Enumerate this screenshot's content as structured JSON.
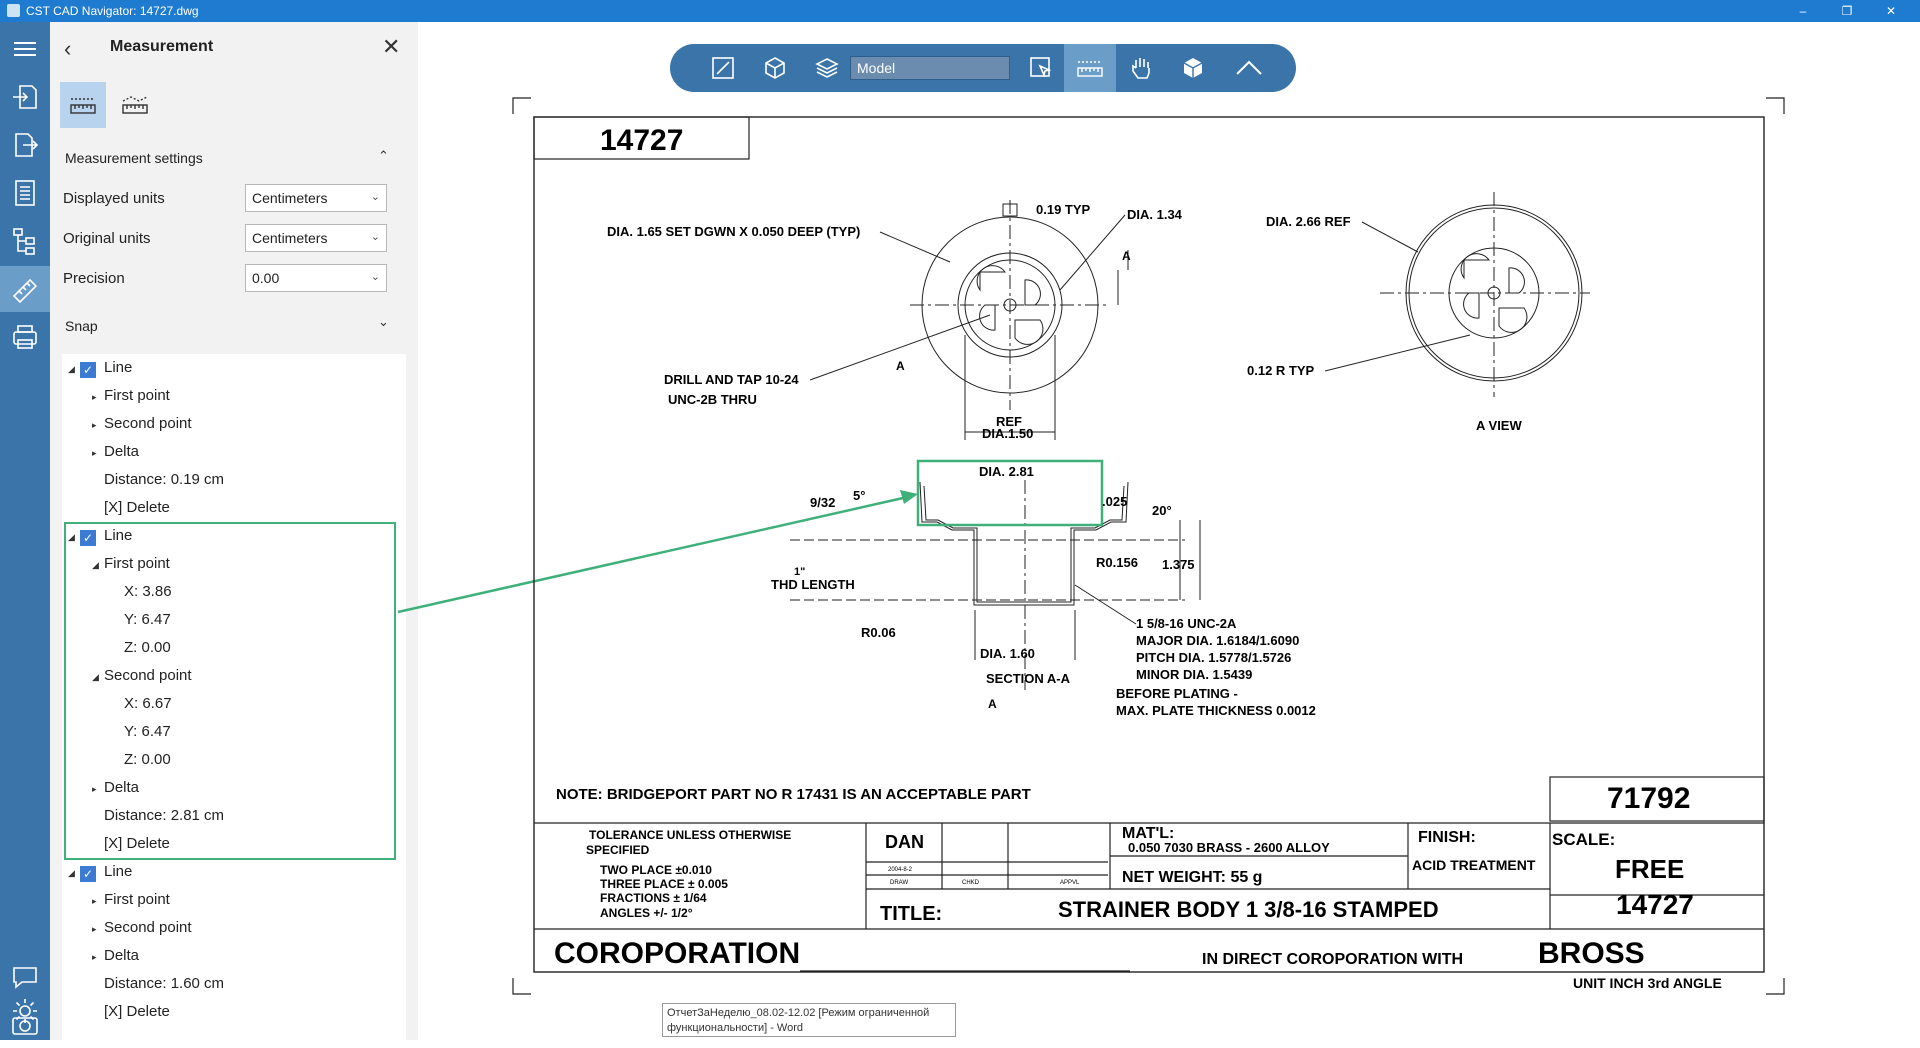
{
  "window": {
    "title": "CST CAD Navigator: 14727.dwg"
  },
  "panel": {
    "title": "Measurement",
    "settings_header": "Measurement settings",
    "displayed_units_label": "Displayed units",
    "displayed_units_value": "Centimeters",
    "original_units_label": "Original units",
    "original_units_value": "Centimeters",
    "precision_label": "Precision",
    "precision_value": "0.00",
    "snap_label": "Snap"
  },
  "tree": {
    "line1": {
      "label": "Line",
      "first": "First point",
      "second": "Second point",
      "delta": "Delta",
      "distance": "Distance: 0.19 cm",
      "delete": "[X] Delete"
    },
    "line2": {
      "label": "Line",
      "first": "First point",
      "fx": "X: 3.86",
      "fy": "Y: 6.47",
      "fz": "Z: 0.00",
      "second": "Second point",
      "sx": "X: 6.67",
      "sy": "Y: 6.47",
      "sz": "Z: 0.00",
      "delta": "Delta",
      "distance": "Distance: 2.81 cm",
      "delete": "[X] Delete"
    },
    "line3": {
      "label": "Line",
      "first": "First point",
      "second": "Second point",
      "delta": "Delta",
      "distance": "Distance: 1.60 cm",
      "delete": "[X] Delete"
    }
  },
  "toolbar": {
    "model_value": "Model"
  },
  "drawing": {
    "dwg_no_top": "14727",
    "labels": {
      "dia165": "DIA. 1.65 SET DGWN X 0.050 DEEP (TYP)",
      "typ019": "0.19 TYP",
      "dia134": "DIA. 1.34",
      "a_top": "A",
      "drill": "DRILL AND TAP 10-24",
      "unc2b": "UNC-2B THRU",
      "a_left": "A",
      "ref": "REF",
      "dia150": "DIA.1.50",
      "dia266": "DIA. 2.66 REF",
      "r012": "0.12 R TYP",
      "aview": "A VIEW",
      "dia281": "DIA. 2.81",
      "d932": "9/32",
      "deg5": "5°",
      "d025": ".025",
      "deg20": "20°",
      "r0156": "R0.156",
      "d1375": "1.375",
      "thd": "THD LENGTH",
      "one": "1\"",
      "r006": "R0.06",
      "dia160": "DIA. 1.60",
      "secaa": "SECTION A-A",
      "a_bot": "A",
      "unc2a": "1 5/8-16 UNC-2A",
      "major": "MAJOR DIA. 1.6184/1.6090",
      "pitch": "PITCH DIA. 1.5778/1.5726",
      "minor": "MINOR DIA. 1.5439",
      "before": "BEFORE PLATING -",
      "maxplate": "MAX. PLATE THICKNESS 0.0012",
      "note": "NOTE: BRIDGEPORT PART NO R 17431 IS AN ACCEPTABLE PART"
    },
    "titleblock": {
      "part_no": "71792",
      "tol1": "TOLERANCE UNLESS OTHERWISE",
      "tol2": "SPECIFIED",
      "tol3": "TWO PLACE  ±0.010",
      "tol4": "THREE PLACE  ±  0.005",
      "tol5": "FRACTIONS  ±  1/64",
      "tol6": "ANGLES   +/- 1/2°",
      "dan": "DAN",
      "date": "2004-8-2",
      "draw": "DRAW",
      "chkd": "CHKD",
      "apvl": "APPVL",
      "matl": "MAT'L:",
      "matl_val": "0.050 7030 BRASS - 2600 ALLOY",
      "net": "NET WEIGHT:   55  g",
      "finish": "FINISH:",
      "acid": "ACID TREATMENT",
      "scale": "SCALE:",
      "free": "FREE",
      "title_label": "TITLE:",
      "title_val": "STRAINER BODY 1 3/8-16 STAMPED",
      "dwg_no": "14727",
      "corp": "COROPORATION",
      "direct": "IN DIRECT COROPORATION WITH",
      "bross": "BROSS",
      "unit": "UNIT  INCH  3rd  ANGLE"
    }
  },
  "tooltip": {
    "line1": "ОтчетЗаНеделю_08.02-12.02 [Режим ограниченной",
    "line2": "функциональности] - Word"
  }
}
